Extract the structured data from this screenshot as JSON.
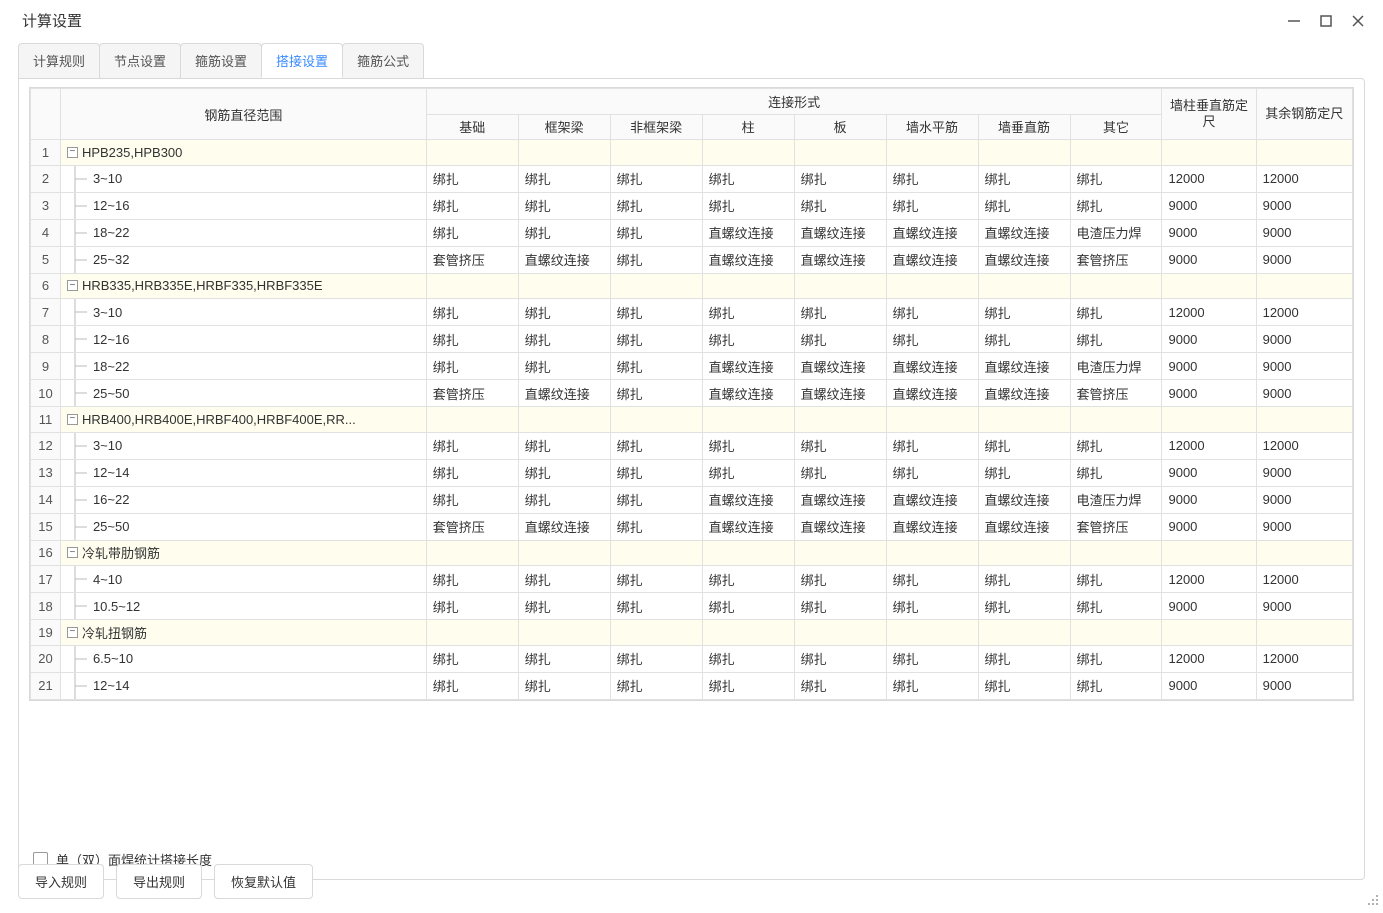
{
  "title": "计算设置",
  "tabs": [
    "计算规则",
    "节点设置",
    "箍筋设置",
    "搭接设置",
    "箍筋公式"
  ],
  "active_tab_index": 3,
  "headers": {
    "range": "钢筋直径范围",
    "conn_group": "连接形式",
    "conn": [
      "基础",
      "框架梁",
      "非框架梁",
      "柱",
      "板",
      "墙水平筋",
      "墙垂直筋",
      "其它"
    ],
    "fix1": "墙柱垂直筋定尺",
    "fix2": "其余钢筋定尺"
  },
  "rows": [
    {
      "n": "1",
      "type": "group",
      "label": "HPB235,HPB300"
    },
    {
      "n": "2",
      "type": "leaf",
      "label": "3~10",
      "v": [
        "绑扎",
        "绑扎",
        "绑扎",
        "绑扎",
        "绑扎",
        "绑扎",
        "绑扎",
        "绑扎",
        "12000",
        "12000"
      ]
    },
    {
      "n": "3",
      "type": "leaf",
      "label": "12~16",
      "v": [
        "绑扎",
        "绑扎",
        "绑扎",
        "绑扎",
        "绑扎",
        "绑扎",
        "绑扎",
        "绑扎",
        "9000",
        "9000"
      ]
    },
    {
      "n": "4",
      "type": "leaf",
      "label": "18~22",
      "v": [
        "绑扎",
        "绑扎",
        "绑扎",
        "直螺纹连接",
        "直螺纹连接",
        "直螺纹连接",
        "直螺纹连接",
        "电渣压力焊",
        "9000",
        "9000"
      ]
    },
    {
      "n": "5",
      "type": "leaf",
      "label": "25~32",
      "v": [
        "套管挤压",
        "直螺纹连接",
        "绑扎",
        "直螺纹连接",
        "直螺纹连接",
        "直螺纹连接",
        "直螺纹连接",
        "套管挤压",
        "9000",
        "9000"
      ]
    },
    {
      "n": "6",
      "type": "group",
      "label": "HRB335,HRB335E,HRBF335,HRBF335E"
    },
    {
      "n": "7",
      "type": "leaf",
      "label": "3~10",
      "v": [
        "绑扎",
        "绑扎",
        "绑扎",
        "绑扎",
        "绑扎",
        "绑扎",
        "绑扎",
        "绑扎",
        "12000",
        "12000"
      ]
    },
    {
      "n": "8",
      "type": "leaf",
      "label": "12~16",
      "v": [
        "绑扎",
        "绑扎",
        "绑扎",
        "绑扎",
        "绑扎",
        "绑扎",
        "绑扎",
        "绑扎",
        "9000",
        "9000"
      ]
    },
    {
      "n": "9",
      "type": "leaf",
      "label": "18~22",
      "v": [
        "绑扎",
        "绑扎",
        "绑扎",
        "直螺纹连接",
        "直螺纹连接",
        "直螺纹连接",
        "直螺纹连接",
        "电渣压力焊",
        "9000",
        "9000"
      ]
    },
    {
      "n": "10",
      "type": "leaf",
      "label": "25~50",
      "v": [
        "套管挤压",
        "直螺纹连接",
        "绑扎",
        "直螺纹连接",
        "直螺纹连接",
        "直螺纹连接",
        "直螺纹连接",
        "套管挤压",
        "9000",
        "9000"
      ]
    },
    {
      "n": "11",
      "type": "group",
      "label": "HRB400,HRB400E,HRBF400,HRBF400E,RR..."
    },
    {
      "n": "12",
      "type": "leaf",
      "label": "3~10",
      "v": [
        "绑扎",
        "绑扎",
        "绑扎",
        "绑扎",
        "绑扎",
        "绑扎",
        "绑扎",
        "绑扎",
        "12000",
        "12000"
      ]
    },
    {
      "n": "13",
      "type": "leaf",
      "label": "12~14",
      "v": [
        "绑扎",
        "绑扎",
        "绑扎",
        "绑扎",
        "绑扎",
        "绑扎",
        "绑扎",
        "绑扎",
        "9000",
        "9000"
      ]
    },
    {
      "n": "14",
      "type": "leaf",
      "label": "16~22",
      "v": [
        "绑扎",
        "绑扎",
        "绑扎",
        "直螺纹连接",
        "直螺纹连接",
        "直螺纹连接",
        "直螺纹连接",
        "电渣压力焊",
        "9000",
        "9000"
      ]
    },
    {
      "n": "15",
      "type": "leaf",
      "label": "25~50",
      "v": [
        "套管挤压",
        "直螺纹连接",
        "绑扎",
        "直螺纹连接",
        "直螺纹连接",
        "直螺纹连接",
        "直螺纹连接",
        "套管挤压",
        "9000",
        "9000"
      ]
    },
    {
      "n": "16",
      "type": "group",
      "label": "冷轧带肋钢筋"
    },
    {
      "n": "17",
      "type": "leaf",
      "label": "4~10",
      "v": [
        "绑扎",
        "绑扎",
        "绑扎",
        "绑扎",
        "绑扎",
        "绑扎",
        "绑扎",
        "绑扎",
        "12000",
        "12000"
      ]
    },
    {
      "n": "18",
      "type": "leaf",
      "label": "10.5~12",
      "v": [
        "绑扎",
        "绑扎",
        "绑扎",
        "绑扎",
        "绑扎",
        "绑扎",
        "绑扎",
        "绑扎",
        "9000",
        "9000"
      ]
    },
    {
      "n": "19",
      "type": "group",
      "label": "冷轧扭钢筋"
    },
    {
      "n": "20",
      "type": "leaf",
      "label": "6.5~10",
      "v": [
        "绑扎",
        "绑扎",
        "绑扎",
        "绑扎",
        "绑扎",
        "绑扎",
        "绑扎",
        "绑扎",
        "12000",
        "12000"
      ]
    },
    {
      "n": "21",
      "type": "leaf",
      "label": "12~14",
      "v": [
        "绑扎",
        "绑扎",
        "绑扎",
        "绑扎",
        "绑扎",
        "绑扎",
        "绑扎",
        "绑扎",
        "9000",
        "9000"
      ]
    }
  ],
  "checkbox_label": "单（双）面焊统计搭接长度",
  "buttons": {
    "import": "导入规则",
    "export": "导出规则",
    "reset": "恢复默认值"
  }
}
